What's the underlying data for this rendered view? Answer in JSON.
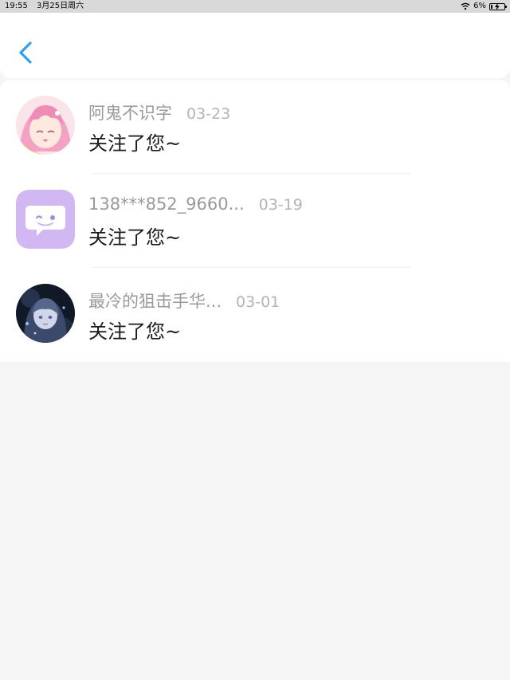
{
  "status_bar": {
    "time": "19:55",
    "date": "3月25日周六",
    "battery_percent": "6%"
  },
  "header": {
    "back_icon": "chevron-left-icon",
    "accent_color": "#2f9ff2"
  },
  "notifications": [
    {
      "name": "阿鬼不识字",
      "date": "03-23",
      "message": "关注了您~",
      "avatar": "anime-girl-avatar"
    },
    {
      "name": "138***852_9660...",
      "date": "03-19",
      "message": "关注了您~",
      "avatar": "chat-bubble-avatar"
    },
    {
      "name": "最冷的狙击手华...",
      "date": "03-01",
      "message": "关注了您~",
      "avatar": "dark-anime-avatar"
    }
  ]
}
